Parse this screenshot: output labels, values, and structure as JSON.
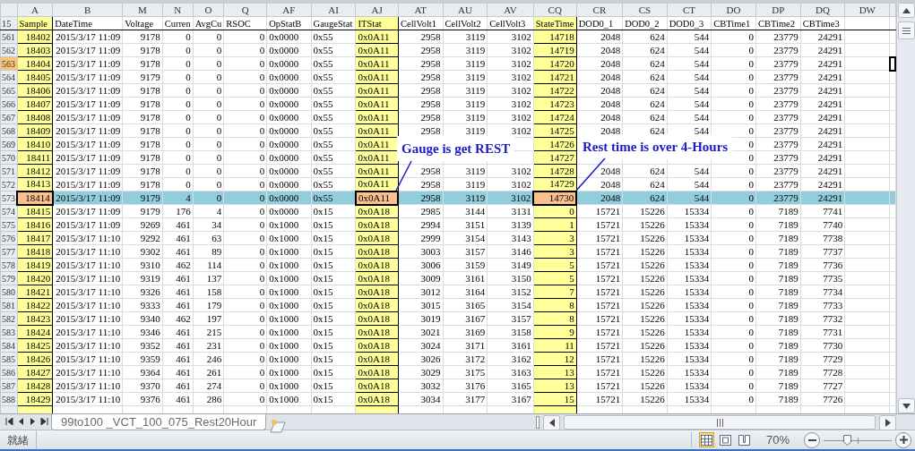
{
  "columns": [
    {
      "letter": "A",
      "name": "Sample",
      "highlighted": true
    },
    {
      "letter": "B",
      "name": "DateTime",
      "highlighted": false
    },
    {
      "letter": "M",
      "name": "Voltage",
      "highlighted": false
    },
    {
      "letter": "N",
      "name": "Curren",
      "highlighted": false
    },
    {
      "letter": "O",
      "name": "AvgCu",
      "highlighted": false
    },
    {
      "letter": "Q",
      "name": "RSOC",
      "highlighted": false
    },
    {
      "letter": "AF",
      "name": "OpStatB",
      "highlighted": false
    },
    {
      "letter": "AI",
      "name": "GaugeStat",
      "highlighted": false
    },
    {
      "letter": "AJ",
      "name": "ITStat",
      "highlighted": true
    },
    {
      "letter": "AT",
      "name": "CellVolt1",
      "highlighted": false
    },
    {
      "letter": "AU",
      "name": "CellVolt2",
      "highlighted": false
    },
    {
      "letter": "AV",
      "name": "CellVolt3",
      "highlighted": false
    },
    {
      "letter": "CQ",
      "name": "StateTime",
      "highlighted": true
    },
    {
      "letter": "CR",
      "name": "DOD0_1",
      "highlighted": false
    },
    {
      "letter": "CS",
      "name": "DOD0_2",
      "highlighted": false
    },
    {
      "letter": "CT",
      "name": "DOD0_3",
      "highlighted": false
    },
    {
      "letter": "DO",
      "name": "CBTime1",
      "highlighted": false
    },
    {
      "letter": "DP",
      "name": "CBTime2",
      "highlighted": false
    },
    {
      "letter": "DQ",
      "name": "CBTime3",
      "highlighted": false
    },
    {
      "letter": "DW",
      "highlighted": false
    }
  ],
  "header_row": "15",
  "rows": [
    {
      "row": "561",
      "selected": false,
      "active": false,
      "cells": [
        "18402",
        "2015/3/17 11:09",
        "9178",
        "0",
        "0",
        "0",
        "0x0000",
        "0x55",
        "0x0A11",
        "2958",
        "3119",
        "3102",
        "14718",
        "2048",
        "624",
        "544",
        "0",
        "23779",
        "24291"
      ]
    },
    {
      "row": "562",
      "selected": false,
      "active": false,
      "cells": [
        "18403",
        "2015/3/17 11:09",
        "9178",
        "0",
        "0",
        "0",
        "0x0000",
        "0x55",
        "0x0A11",
        "2958",
        "3119",
        "3102",
        "14719",
        "2048",
        "624",
        "544",
        "0",
        "23779",
        "24291"
      ]
    },
    {
      "row": "563",
      "selected": false,
      "active": true,
      "cells": [
        "18404",
        "2015/3/17 11:09",
        "9178",
        "0",
        "0",
        "0",
        "0x0000",
        "0x55",
        "0x0A11",
        "2958",
        "3119",
        "3102",
        "14720",
        "2048",
        "624",
        "544",
        "0",
        "23779",
        "24291"
      ]
    },
    {
      "row": "564",
      "selected": false,
      "active": false,
      "cells": [
        "18405",
        "2015/3/17 11:09",
        "9179",
        "0",
        "0",
        "0",
        "0x0000",
        "0x55",
        "0x0A11",
        "2958",
        "3119",
        "3102",
        "14721",
        "2048",
        "624",
        "544",
        "0",
        "23779",
        "24291"
      ]
    },
    {
      "row": "565",
      "selected": false,
      "active": false,
      "cells": [
        "18406",
        "2015/3/17 11:09",
        "9178",
        "0",
        "0",
        "0",
        "0x0000",
        "0x55",
        "0x0A11",
        "2958",
        "3119",
        "3102",
        "14722",
        "2048",
        "624",
        "544",
        "0",
        "23779",
        "24291"
      ]
    },
    {
      "row": "566",
      "selected": false,
      "active": false,
      "cells": [
        "18407",
        "2015/3/17 11:09",
        "9178",
        "0",
        "0",
        "0",
        "0x0000",
        "0x55",
        "0x0A11",
        "2958",
        "3119",
        "3102",
        "14723",
        "2048",
        "624",
        "544",
        "0",
        "23779",
        "24291"
      ]
    },
    {
      "row": "567",
      "selected": false,
      "active": false,
      "cells": [
        "18408",
        "2015/3/17 11:09",
        "9178",
        "0",
        "0",
        "0",
        "0x0000",
        "0x55",
        "0x0A11",
        "2958",
        "3119",
        "3102",
        "14724",
        "2048",
        "624",
        "544",
        "0",
        "23779",
        "24291"
      ]
    },
    {
      "row": "568",
      "selected": false,
      "active": false,
      "cells": [
        "18409",
        "2015/3/17 11:09",
        "9178",
        "0",
        "0",
        "0",
        "0x0000",
        "0x55",
        "0x0A11",
        "2958",
        "3119",
        "3102",
        "14725",
        "2048",
        "624",
        "544",
        "0",
        "23779",
        "24291"
      ]
    },
    {
      "row": "569",
      "selected": false,
      "active": false,
      "cells": [
        "18410",
        "2015/3/17 11:09",
        "9178",
        "0",
        "0",
        "0",
        "0x0000",
        "0x55",
        "0x0A11",
        null,
        null,
        null,
        "14726",
        null,
        null,
        null,
        "0",
        "23779",
        "24291"
      ]
    },
    {
      "row": "570",
      "selected": false,
      "active": false,
      "cells": [
        "18411",
        "2015/3/17 11:09",
        "9178",
        "0",
        "0",
        "0",
        "0x0000",
        "0x55",
        "0x0A11",
        null,
        null,
        null,
        "14727",
        null,
        null,
        null,
        "0",
        "23779",
        "24291"
      ]
    },
    {
      "row": "571",
      "selected": false,
      "active": false,
      "cells": [
        "18412",
        "2015/3/17 11:09",
        "9178",
        "0",
        "0",
        "0",
        "0x0000",
        "0x55",
        "0x0A11",
        "2958",
        "3119",
        "3102",
        "14728",
        "2048",
        "624",
        "544",
        "0",
        "23779",
        "24291"
      ]
    },
    {
      "row": "572",
      "selected": false,
      "active": false,
      "cells": [
        "18413",
        "2015/3/17 11:09",
        "9178",
        "0",
        "0",
        "0",
        "0x0000",
        "0x55",
        "0x0A11",
        "2958",
        "3119",
        "3102",
        "14729",
        "2048",
        "624",
        "544",
        "0",
        "23779",
        "24291"
      ]
    },
    {
      "row": "573",
      "selected": true,
      "active": false,
      "cells": [
        "18414",
        "2015/3/17 11:09",
        "9179",
        "4",
        "0",
        "0",
        "0x0000",
        "0x55",
        "0x0A11",
        "2958",
        "3119",
        "3102",
        "14730",
        "2048",
        "624",
        "544",
        "0",
        "23779",
        "24291"
      ]
    },
    {
      "row": "574",
      "selected": false,
      "active": false,
      "cells": [
        "18415",
        "2015/3/17 11:09",
        "9179",
        "176",
        "4",
        "0",
        "0x0000",
        "0x15",
        "0x0A18",
        "2985",
        "3144",
        "3131",
        "0",
        "15721",
        "15226",
        "15334",
        "0",
        "7189",
        "7741"
      ]
    },
    {
      "row": "575",
      "selected": false,
      "active": false,
      "cells": [
        "18416",
        "2015/3/17 11:09",
        "9269",
        "461",
        "34",
        "0",
        "0x1000",
        "0x15",
        "0x0A18",
        "2994",
        "3151",
        "3139",
        "1",
        "15721",
        "15226",
        "15334",
        "0",
        "7189",
        "7740"
      ]
    },
    {
      "row": "576",
      "selected": false,
      "active": false,
      "cells": [
        "18417",
        "2015/3/17 11:10",
        "9292",
        "461",
        "63",
        "0",
        "0x1000",
        "0x15",
        "0x0A18",
        "2999",
        "3154",
        "3143",
        "3",
        "15721",
        "15226",
        "15334",
        "0",
        "7189",
        "7738"
      ]
    },
    {
      "row": "577",
      "selected": false,
      "active": false,
      "cells": [
        "18418",
        "2015/3/17 11:10",
        "9302",
        "461",
        "89",
        "0",
        "0x1000",
        "0x15",
        "0x0A18",
        "3003",
        "3157",
        "3146",
        "3",
        "15721",
        "15226",
        "15334",
        "0",
        "7189",
        "7737"
      ]
    },
    {
      "row": "578",
      "selected": false,
      "active": false,
      "cells": [
        "18419",
        "2015/3/17 11:10",
        "9310",
        "462",
        "114",
        "0",
        "0x1000",
        "0x15",
        "0x0A18",
        "3006",
        "3159",
        "3149",
        "5",
        "15721",
        "15226",
        "15334",
        "0",
        "7189",
        "7736"
      ]
    },
    {
      "row": "579",
      "selected": false,
      "active": false,
      "cells": [
        "18420",
        "2015/3/17 11:10",
        "9319",
        "461",
        "137",
        "0",
        "0x1000",
        "0x15",
        "0x0A18",
        "3009",
        "3161",
        "3150",
        "5",
        "15721",
        "15226",
        "15334",
        "0",
        "7189",
        "7735"
      ]
    },
    {
      "row": "580",
      "selected": false,
      "active": false,
      "cells": [
        "18421",
        "2015/3/17 11:10",
        "9326",
        "461",
        "158",
        "0",
        "0x1000",
        "0x15",
        "0x0A18",
        "3012",
        "3164",
        "3152",
        "7",
        "15721",
        "15226",
        "15334",
        "0",
        "7189",
        "7734"
      ]
    },
    {
      "row": "581",
      "selected": false,
      "active": false,
      "cells": [
        "18422",
        "2015/3/17 11:10",
        "9333",
        "461",
        "179",
        "0",
        "0x1000",
        "0x15",
        "0x0A18",
        "3015",
        "3165",
        "3154",
        "8",
        "15721",
        "15226",
        "15334",
        "0",
        "7189",
        "7733"
      ]
    },
    {
      "row": "582",
      "selected": false,
      "active": false,
      "cells": [
        "18423",
        "2015/3/17 11:10",
        "9340",
        "462",
        "197",
        "0",
        "0x1000",
        "0x15",
        "0x0A18",
        "3019",
        "3167",
        "3157",
        "8",
        "15721",
        "15226",
        "15334",
        "0",
        "7189",
        "7732"
      ]
    },
    {
      "row": "583",
      "selected": false,
      "active": false,
      "cells": [
        "18424",
        "2015/3/17 11:10",
        "9346",
        "461",
        "215",
        "0",
        "0x1000",
        "0x15",
        "0x0A18",
        "3021",
        "3169",
        "3158",
        "9",
        "15721",
        "15226",
        "15334",
        "0",
        "7189",
        "7731"
      ]
    },
    {
      "row": "584",
      "selected": false,
      "active": false,
      "cells": [
        "18425",
        "2015/3/17 11:10",
        "9352",
        "461",
        "231",
        "0",
        "0x1000",
        "0x15",
        "0x0A18",
        "3024",
        "3171",
        "3161",
        "11",
        "15721",
        "15226",
        "15334",
        "0",
        "7189",
        "7730"
      ]
    },
    {
      "row": "585",
      "selected": false,
      "active": false,
      "cells": [
        "18426",
        "2015/3/17 11:10",
        "9359",
        "461",
        "246",
        "0",
        "0x1000",
        "0x15",
        "0x0A18",
        "3026",
        "3172",
        "3162",
        "12",
        "15721",
        "15226",
        "15334",
        "0",
        "7189",
        "7729"
      ]
    },
    {
      "row": "586",
      "selected": false,
      "active": false,
      "cells": [
        "18427",
        "2015/3/17 11:10",
        "9364",
        "461",
        "261",
        "0",
        "0x1000",
        "0x15",
        "0x0A18",
        "3029",
        "3175",
        "3163",
        "13",
        "15721",
        "15226",
        "15334",
        "0",
        "7189",
        "7728"
      ]
    },
    {
      "row": "587",
      "selected": false,
      "active": false,
      "cells": [
        "18428",
        "2015/3/17 11:10",
        "9370",
        "461",
        "274",
        "0",
        "0x1000",
        "0x15",
        "0x0A18",
        "3032",
        "3176",
        "3165",
        "13",
        "15721",
        "15226",
        "15334",
        "0",
        "7189",
        "7727"
      ]
    },
    {
      "row": "588",
      "selected": false,
      "active": false,
      "cells": [
        "18429",
        "2015/3/17 11:10",
        "9376",
        "461",
        "286",
        "0",
        "0x1000",
        "0x15",
        "0x0A18",
        "3034",
        "3177",
        "3167",
        "15",
        "15721",
        "15226",
        "15334",
        "0",
        "7189",
        "7726"
      ]
    }
  ],
  "callouts": [
    {
      "text": "Gauge is get REST"
    },
    {
      "text": "Rest time is over 4-Hours"
    }
  ],
  "sheet_tab": {
    "label": "99to100 _VCT_100_075_Rest20Hour",
    "selected": true
  },
  "status_bar": {
    "text": "就緒",
    "views": [
      {
        "kind": "normal",
        "selected": true
      },
      {
        "kind": "page-layout",
        "selected": false
      },
      {
        "kind": "page-break",
        "selected": false
      }
    ],
    "zoom": "70%",
    "zoom_slider": {
      "level": 0.34
    }
  }
}
